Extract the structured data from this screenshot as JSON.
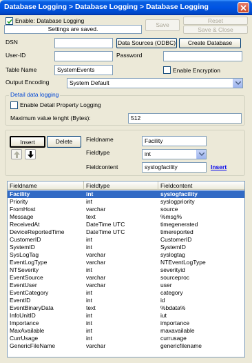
{
  "window": {
    "title": "Database Logging > Database Logging > Database Logging"
  },
  "header": {
    "enable_label": "Enable: Database Logging",
    "enable_checked": true,
    "status": "Settings are saved.",
    "save_label": "Save",
    "reset_label": "Reset",
    "save_close_label": "Save & Close"
  },
  "connection": {
    "dsn_label": "DSN",
    "dsn_value": "",
    "data_sources_button": "Data Sources (ODBC)",
    "create_database_button": "Create Database",
    "userid_label": "User-ID",
    "userid_value": "",
    "password_label": "Password",
    "password_value": "",
    "table_name_label": "Table Name",
    "table_name_value": "SystemEvents",
    "encryption_label": "Enable Encryption",
    "encryption_checked": false,
    "output_encoding_label": "Output Encoding",
    "output_encoding_value": "System Default"
  },
  "detail": {
    "group_title": "Detail data logging",
    "enable_label": "Enable Detail Property Logging",
    "enable_checked": false,
    "max_len_label": "Maximum value lenght (Bytes):",
    "max_len_value": "512"
  },
  "field_editor": {
    "insert_label": "Insert",
    "delete_label": "Delete",
    "fieldname_label": "Fieldname",
    "fieldname_value": "Facility",
    "fieldtype_label": "Fieldtype",
    "fieldtype_value": "int",
    "fieldcontent_label": "Fieldcontent",
    "fieldcontent_value": "syslogfacility",
    "insert_link": "Insert",
    "up_icon": "arrow-up-icon",
    "down_icon": "arrow-down-icon"
  },
  "fields_table": {
    "columns": [
      "Fieldname",
      "Fieldtype",
      "Fieldcontent"
    ],
    "selected_index": 0,
    "rows": [
      [
        "Facility",
        "int",
        "syslogfacility"
      ],
      [
        "Priority",
        "int",
        "syslogpriority"
      ],
      [
        "FromHost",
        "varchar",
        "source"
      ],
      [
        "Message",
        "text",
        "%msg%"
      ],
      [
        "ReceivedAt",
        "DateTime UTC",
        "timegenerated"
      ],
      [
        "DeviceReportedTime",
        "DateTime UTC",
        "timereported"
      ],
      [
        "CustomerID",
        "int",
        "CustomerID"
      ],
      [
        "SystemID",
        "int",
        "SystemID"
      ],
      [
        "SysLogTag",
        "varchar",
        "syslogtag"
      ],
      [
        "EventLogType",
        "varchar",
        "NTEventLogType"
      ],
      [
        "NTSeverity",
        "int",
        "severityid"
      ],
      [
        "EventSource",
        "varchar",
        "sourceproc"
      ],
      [
        "EventUser",
        "varchar",
        "user"
      ],
      [
        "EventCategory",
        "int",
        "category"
      ],
      [
        "EventID",
        "int",
        "id"
      ],
      [
        "EventBinaryData",
        "text",
        "%bdata%"
      ],
      [
        "InfoUnitID",
        "int",
        "iut"
      ],
      [
        "Importance",
        "int",
        "importance"
      ],
      [
        "MaxAvailable",
        "int",
        "maxavailable"
      ],
      [
        "CurrUsage",
        "int",
        "currusage"
      ],
      [
        "GenericFileName",
        "varchar",
        "genericfilename"
      ]
    ]
  },
  "colors": {
    "titlebar": "#0054e3",
    "selection": "#316ac5",
    "group_title": "#0046d5",
    "link": "#0000ee"
  }
}
